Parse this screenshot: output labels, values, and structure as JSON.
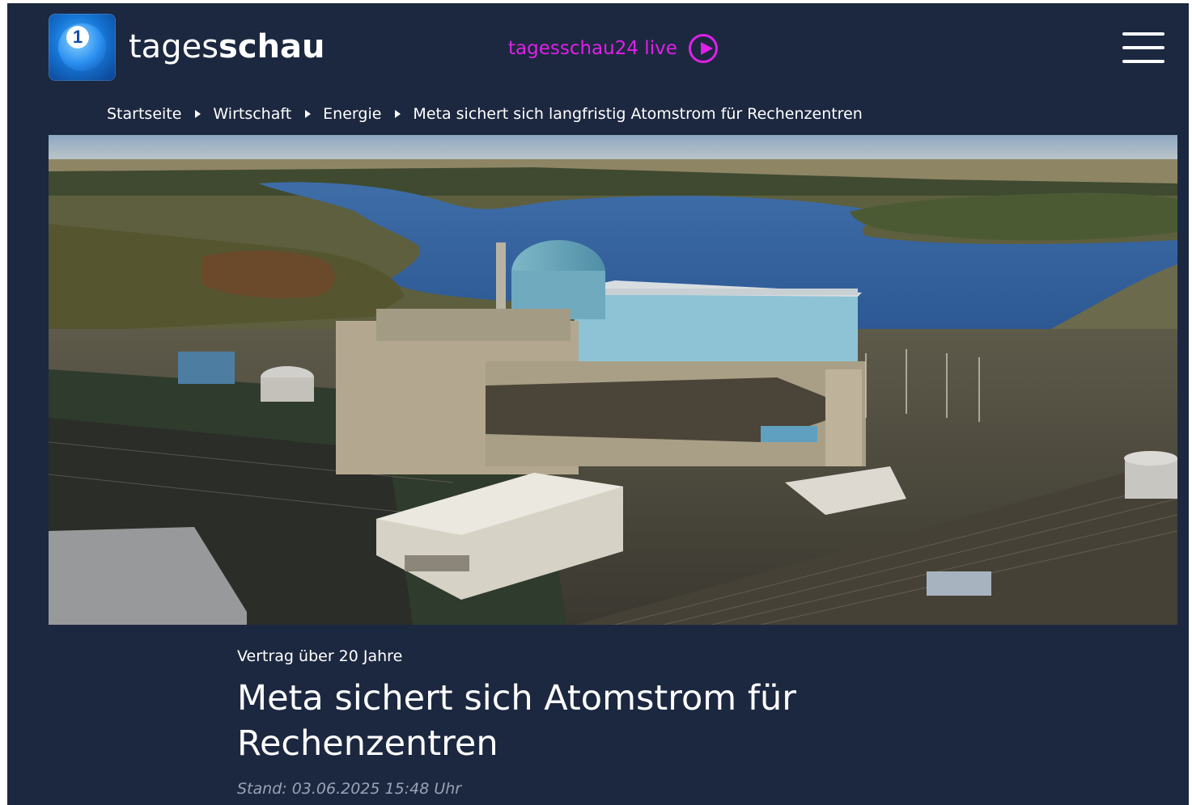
{
  "header": {
    "brand_regular": "tages",
    "brand_bold": "schau",
    "live_label": "tagesschau24 live"
  },
  "breadcrumb": [
    "Startseite",
    "Wirtschaft",
    "Energie",
    "Meta sichert sich langfristig Atomstrom für Rechenzentren"
  ],
  "article": {
    "topline": "Vertrag über 20 Jahre",
    "headline": "Meta sichert sich Atomstrom für Rechenzentren",
    "stand": "Stand: 03.06.2025 15:48 Uhr"
  },
  "icons": {
    "logo": "ard-one-logo-icon",
    "live": "play-circle-icon",
    "menu": "hamburger-menu-icon"
  },
  "colors": {
    "background": "#1c2840",
    "live_accent": "#e020e8",
    "text": "#ffffff",
    "stand_text": "#9aa3b5"
  }
}
